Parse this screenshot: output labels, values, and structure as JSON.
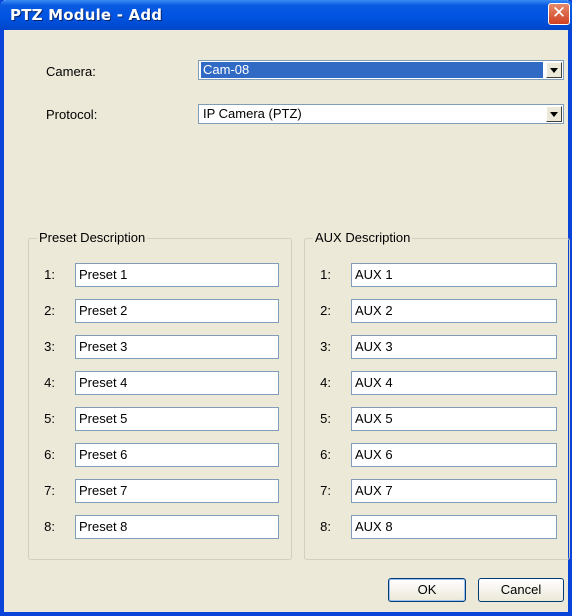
{
  "window": {
    "title": "PTZ Module - Add",
    "close_label": "✕"
  },
  "camera": {
    "label": "Camera:",
    "value": "Cam-08"
  },
  "protocol": {
    "label": "Protocol:",
    "value": "IP Camera (PTZ)"
  },
  "preset": {
    "legend": "Preset Description",
    "rows": [
      {
        "num": "1:",
        "value": "Preset 1"
      },
      {
        "num": "2:",
        "value": "Preset 2"
      },
      {
        "num": "3:",
        "value": "Preset 3"
      },
      {
        "num": "4:",
        "value": "Preset 4"
      },
      {
        "num": "5:",
        "value": "Preset 5"
      },
      {
        "num": "6:",
        "value": "Preset 6"
      },
      {
        "num": "7:",
        "value": "Preset 7"
      },
      {
        "num": "8:",
        "value": "Preset 8"
      }
    ]
  },
  "aux": {
    "legend": "AUX Description",
    "rows": [
      {
        "num": "1:",
        "value": "AUX 1"
      },
      {
        "num": "2:",
        "value": "AUX 2"
      },
      {
        "num": "3:",
        "value": "AUX 3"
      },
      {
        "num": "4:",
        "value": "AUX 4"
      },
      {
        "num": "5:",
        "value": "AUX 5"
      },
      {
        "num": "6:",
        "value": "AUX 6"
      },
      {
        "num": "7:",
        "value": "AUX 7"
      },
      {
        "num": "8:",
        "value": "AUX 8"
      }
    ]
  },
  "buttons": {
    "ok": "OK",
    "cancel": "Cancel"
  },
  "colors": {
    "titlebar": "#0054e3",
    "selection": "#316ac5",
    "dialog_bg": "#ece9d8"
  }
}
